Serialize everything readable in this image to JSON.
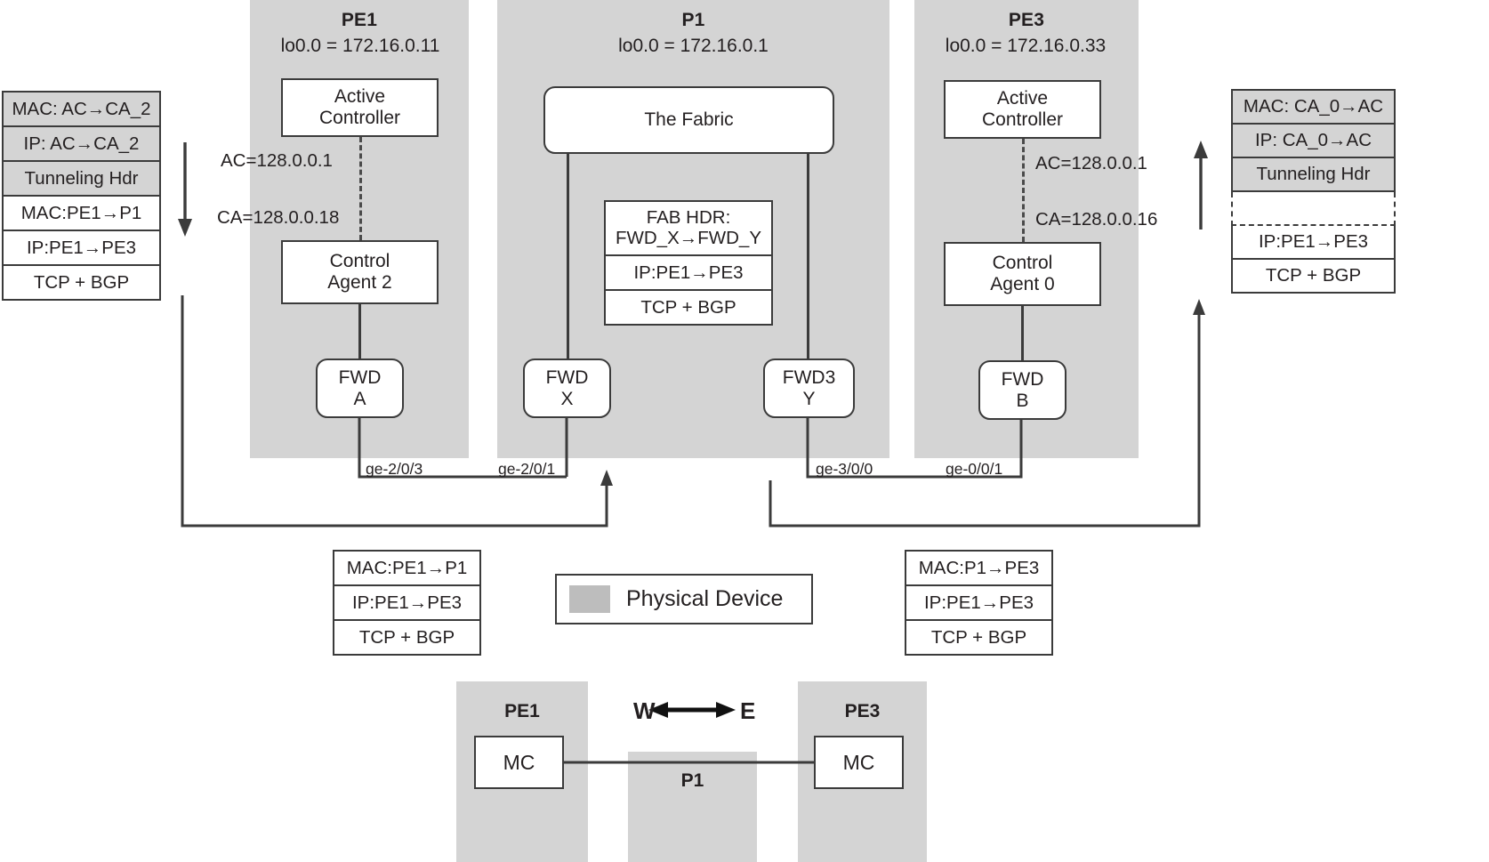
{
  "devices": [
    {
      "name": "PE1",
      "loopback": "lo0.0 = 172.16.0.11"
    },
    {
      "name": "P1",
      "loopback": "lo0.0 = 172.16.0.1"
    },
    {
      "name": "PE3",
      "loopback": "lo0.0 = 172.16.0.33"
    }
  ],
  "pe1": {
    "active_controller": "Active\nController",
    "active_controller_l1": "Active",
    "active_controller_l2": "Controller",
    "control_agent_l1": "Control",
    "control_agent_l2": "Agent 2",
    "ac_label": "AC=128.0.0.1",
    "ca_label": "CA=128.0.0.18",
    "fwd_l1": "FWD",
    "fwd_l2": "A",
    "interface": "ge-2/0/3"
  },
  "p1": {
    "fabric_label": "The Fabric",
    "fwd_x_l1": "FWD",
    "fwd_x_l2": "X",
    "fwd_y_l1": "FWD3",
    "fwd_y_l2": "Y",
    "interface_left": "ge-2/0/1",
    "interface_right": "ge-3/0/0",
    "fab_stack": [
      {
        "line1": "FAB HDR:",
        "line2": "FWD_X→FWD_Y",
        "shaded": false,
        "ghost": false
      },
      {
        "line1": "IP:PE1→PE3",
        "line2": "",
        "shaded": false,
        "ghost": false
      },
      {
        "line1": "TCP + BGP",
        "line2": "",
        "shaded": false,
        "ghost": false
      }
    ]
  },
  "pe3": {
    "active_controller_l1": "Active",
    "active_controller_l2": "Controller",
    "control_agent_l1": "Control",
    "control_agent_l2": "Agent 0",
    "ac_label": "AC=128.0.0.1",
    "ca_label": "CA=128.0.0.16",
    "fwd_l1": "FWD",
    "fwd_l2": "B",
    "interface": "ge-0/0/1"
  },
  "left_stack": [
    {
      "text": "MAC: AC→CA_2",
      "shaded": true,
      "ghost": false
    },
    {
      "text": "IP: AC→CA_2",
      "shaded": true,
      "ghost": false
    },
    {
      "text": "Tunneling Hdr",
      "shaded": true,
      "ghost": false
    },
    {
      "text": "MAC:PE1→P1",
      "shaded": false,
      "ghost": false
    },
    {
      "text": "IP:PE1→PE3",
      "shaded": false,
      "ghost": false
    },
    {
      "text": "TCP + BGP",
      "shaded": false,
      "ghost": false
    }
  ],
  "right_stack": [
    {
      "text": "MAC: CA_0→AC",
      "shaded": true,
      "ghost": false
    },
    {
      "text": "IP: CA_0→AC",
      "shaded": true,
      "ghost": false
    },
    {
      "text": "Tunneling Hdr",
      "shaded": true,
      "ghost": false
    },
    {
      "text": "",
      "shaded": false,
      "ghost": true
    },
    {
      "text": "IP:PE1→PE3",
      "shaded": false,
      "ghost": false
    },
    {
      "text": "TCP + BGP",
      "shaded": false,
      "ghost": false
    }
  ],
  "bottom_left_stack": [
    {
      "text": "MAC:PE1→P1",
      "shaded": false
    },
    {
      "text": "IP:PE1→PE3",
      "shaded": false
    },
    {
      "text": "TCP + BGP",
      "shaded": false
    }
  ],
  "bottom_right_stack": [
    {
      "text": "MAC:P1→PE3",
      "shaded": false
    },
    {
      "text": "IP:PE1→PE3",
      "shaded": false
    },
    {
      "text": "TCP + BGP",
      "shaded": false
    }
  ],
  "legend": {
    "label": "Physical Device",
    "swatch_color": "#bdbdbd"
  },
  "mini": {
    "left_title": "PE1",
    "right_title": "PE3",
    "middle_title": "P1",
    "left_node": "MC",
    "right_node": "MC",
    "west": "W",
    "east": "E"
  },
  "colors": {
    "panel_gray": "#d4d4d4",
    "shade_gray": "#d4d4d4",
    "stroke": "#3b3b3b",
    "text": "#231f20"
  }
}
